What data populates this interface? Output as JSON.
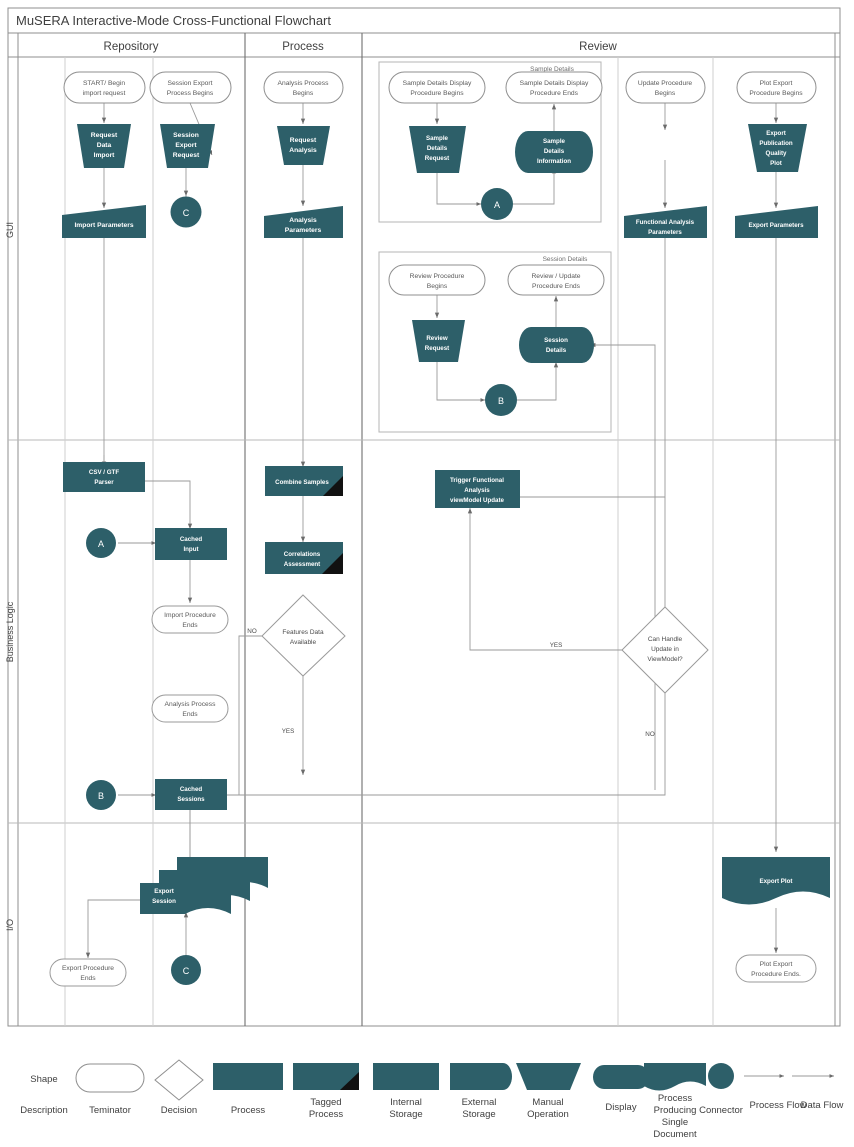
{
  "title": "MuSERA Interactive-Mode Cross-Functional Flowchart",
  "lanes": {
    "columns": [
      {
        "id": "repository",
        "label": "Repository"
      },
      {
        "id": "process",
        "label": "Process"
      },
      {
        "id": "review",
        "label": "Review"
      }
    ],
    "rows": [
      {
        "id": "gui",
        "label": "GUI"
      },
      {
        "id": "business",
        "label": "Business Logic"
      },
      {
        "id": "io",
        "label": "I/O"
      }
    ]
  },
  "groups": [
    {
      "id": "sample-details",
      "label": "Sample Details"
    },
    {
      "id": "session-details",
      "label": "Session Details"
    }
  ],
  "nodes": {
    "start_import": "START/ Begin import request",
    "session_export_begins": "Session Export Process Begins",
    "analysis_begins": "Analysis Process Begins",
    "sample_display_begins": "Sample Details Display Procedure Begins",
    "sample_display_ends": "Sample Details Display Procedure Ends",
    "update_begins": "Update Procedure Begins",
    "plot_export_begins": "Plot Export Procedure Begins",
    "review_begins": "Review Procedure Begins",
    "review_update_ends": "Review / Update Procedure Ends",
    "request_data_import": "Request Data Import",
    "session_export_request": "Session Export Request",
    "request_analysis": "Request Analysis",
    "sample_details_request": "Sample Details Request",
    "sample_details_information": "Sample Details Information",
    "export_pub_plot": "Export Publication Quality Plot",
    "review_request": "Review Request",
    "session_details": "Session Details",
    "import_parameters": "Import Parameters",
    "analysis_parameters": "Analysis Parameters",
    "functional_analysis_parameters": "Functional Analysis Parameters",
    "export_parameters": "Export Parameters",
    "csv_gtf_parser": "CSV / GTF Parser",
    "cached_input": "Cached Input",
    "cached_sessions": "Cached Sessions",
    "combine_samples": "Combine Samples",
    "correlations_assessment": "Correlations Assessment",
    "trigger_viewmodel_update": "Trigger Functional Analysis viewModel Update",
    "import_ends": "Import Procedure Ends",
    "analysis_ends": "Analysis Process Ends",
    "export_ends": "Export Procedure Ends",
    "plot_export_ends": "Plot Export Procedure Ends.",
    "features_data_available": "Features Data Available",
    "can_handle_update": "Can Handle Update in ViewModel?",
    "export_session": "Export Session",
    "export_plot": "Export Plot",
    "connector_a": "A",
    "connector_b": "B",
    "connector_c": "C"
  },
  "edge_labels": {
    "no1": "NO",
    "yes1": "YES",
    "yes2": "YES",
    "no2": "NO"
  },
  "legend": {
    "shape_label": "Shape",
    "description_label": "Description",
    "items": [
      {
        "name": "terminator",
        "label": "Teminator"
      },
      {
        "name": "decision",
        "label": "Decision"
      },
      {
        "name": "process",
        "label": "Process"
      },
      {
        "name": "tagged-process",
        "label": "Tagged Process"
      },
      {
        "name": "internal-storage",
        "label": "Internal Storage"
      },
      {
        "name": "external-storage",
        "label": "External Storage"
      },
      {
        "name": "manual-operation",
        "label": "Manual Operation"
      },
      {
        "name": "display",
        "label": "Display"
      },
      {
        "name": "single-document",
        "label": "Process Producing Single Document"
      },
      {
        "name": "connector",
        "label": "Connector"
      },
      {
        "name": "process-flow",
        "label": "Process Flow"
      },
      {
        "name": "data-flow",
        "label": "Data Flow"
      }
    ]
  },
  "colors": {
    "fill": "#2d5f69",
    "stroke": "#8f8f8f",
    "line": "#9a9a9a",
    "text": "#3f3f3f"
  }
}
